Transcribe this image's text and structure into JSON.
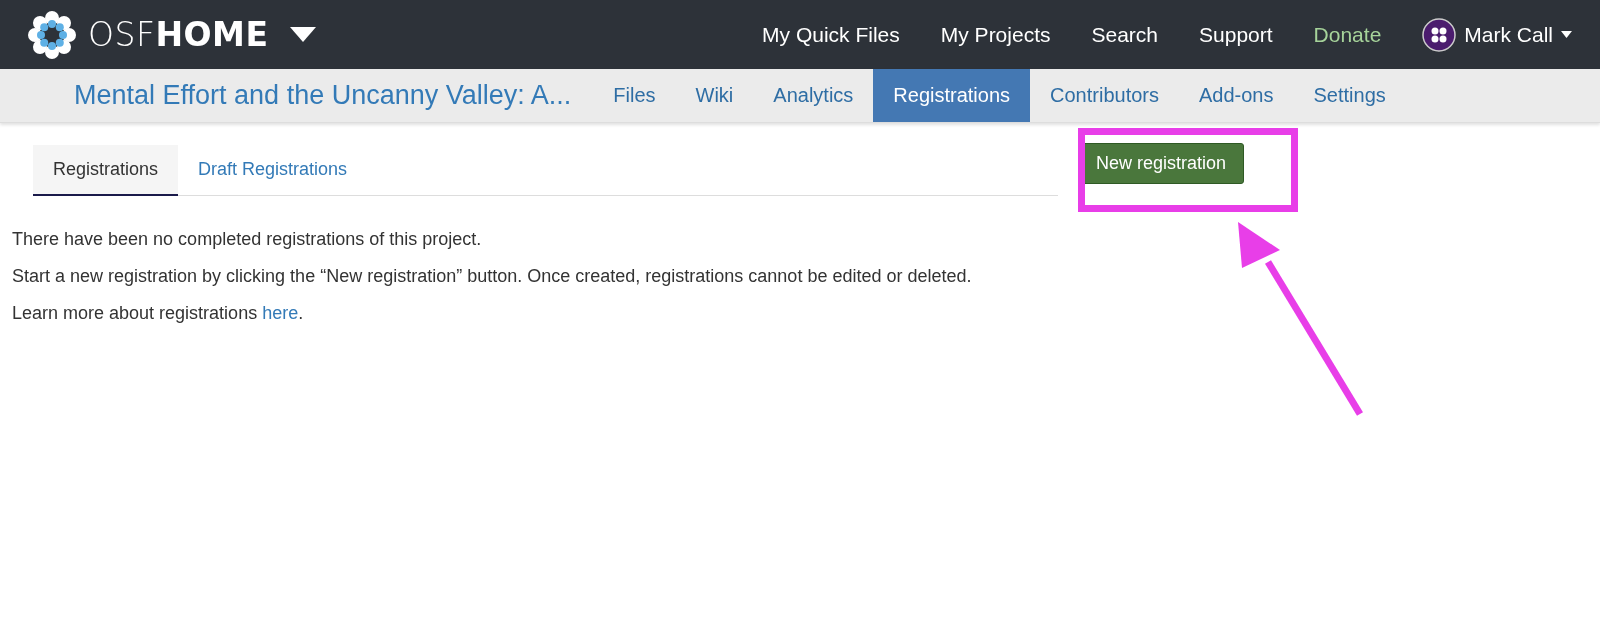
{
  "header": {
    "brand": {
      "light": "OSF",
      "bold": "HOME"
    },
    "nav": [
      {
        "label": "My Quick Files",
        "kind": "link"
      },
      {
        "label": "My Projects",
        "kind": "link"
      },
      {
        "label": "Search",
        "kind": "link"
      },
      {
        "label": "Support",
        "kind": "link"
      },
      {
        "label": "Donate",
        "kind": "donate"
      }
    ],
    "user": {
      "name": "Mark Call"
    }
  },
  "project": {
    "title": "Mental Effort and the Uncanny Valley: A...",
    "tabs": [
      {
        "label": "Files",
        "selected": false
      },
      {
        "label": "Wiki",
        "selected": false
      },
      {
        "label": "Analytics",
        "selected": false
      },
      {
        "label": "Registrations",
        "selected": true
      },
      {
        "label": "Contributors",
        "selected": false
      },
      {
        "label": "Add-ons",
        "selected": false
      },
      {
        "label": "Settings",
        "selected": false
      }
    ]
  },
  "subtabs": [
    {
      "label": "Registrations",
      "selected": true
    },
    {
      "label": "Draft Registrations",
      "selected": false
    }
  ],
  "paragraphs": [
    {
      "text": "There have been no completed registrations of this project."
    },
    {
      "text": "Start a new registration by clicking the “New registration” button. Once created, registrations cannot be edited or deleted."
    },
    {
      "text": "Learn more about registrations ",
      "link": "here",
      "after": "."
    }
  ],
  "new_registration": {
    "label": "New registration",
    "highlighted": true
  }
}
